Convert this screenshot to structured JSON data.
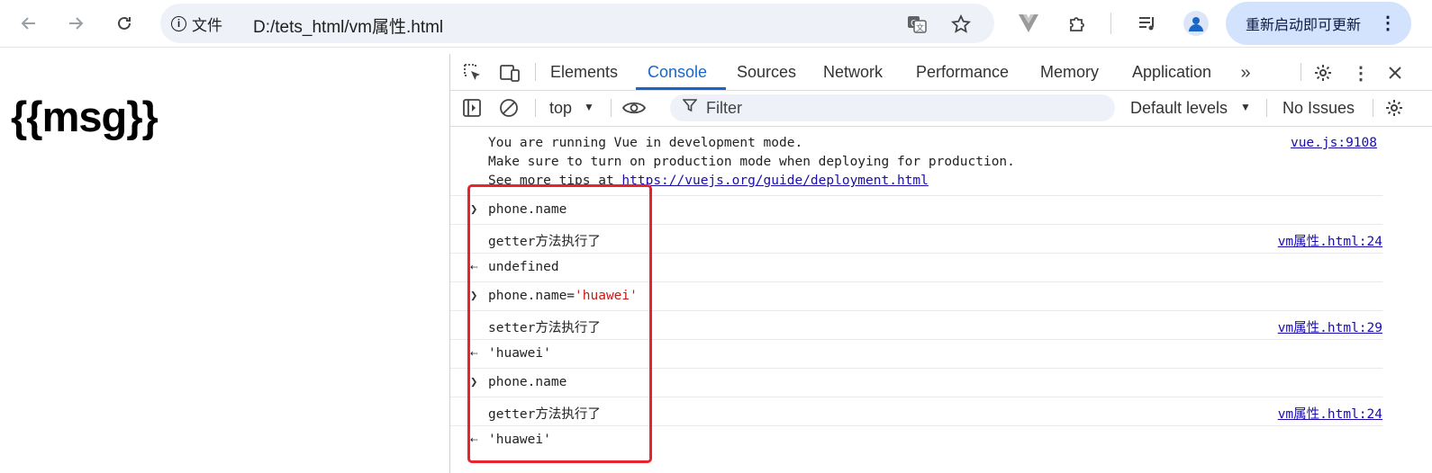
{
  "browser": {
    "site_info_label": "文件",
    "url": "D:/tets_html/vm属性.html",
    "relaunch_label": "重新启动即可更新"
  },
  "page": {
    "heading": "{{msg}}"
  },
  "devtools": {
    "tabs": [
      "Elements",
      "Console",
      "Sources",
      "Network",
      "Performance",
      "Memory",
      "Application"
    ],
    "active_tab": "Console",
    "context": "top",
    "filter_placeholder": "Filter",
    "levels": "Default levels",
    "issues": "No Issues"
  },
  "console": {
    "vue_message": {
      "line1": "You are running Vue in development mode.",
      "line2": "Make sure to turn on production mode when deploying for production.",
      "line3_prefix": "See more tips at ",
      "line3_link": "https://vuejs.org/guide/deployment.html",
      "source": "vue.js:9108"
    },
    "entries": [
      {
        "kind": "input",
        "text": "phone.name"
      },
      {
        "kind": "log",
        "text": "getter方法执行了",
        "source": "vm属性.html:24"
      },
      {
        "kind": "result",
        "text": "undefined"
      },
      {
        "kind": "input",
        "text": "phone.name=",
        "string_part": "'huawei'"
      },
      {
        "kind": "log",
        "text": "setter方法执行了",
        "source": "vm属性.html:29"
      },
      {
        "kind": "result",
        "text": "'huawei'"
      },
      {
        "kind": "input",
        "text": "phone.name"
      },
      {
        "kind": "log",
        "text": "getter方法执行了",
        "source": "vm属性.html:24"
      },
      {
        "kind": "result",
        "text": "'huawei'"
      }
    ]
  },
  "colors": {
    "highlight_box": "#e8232c",
    "active_tab": "#1a66c8",
    "string_value": "#c41a16",
    "link": "#1a0dab"
  }
}
